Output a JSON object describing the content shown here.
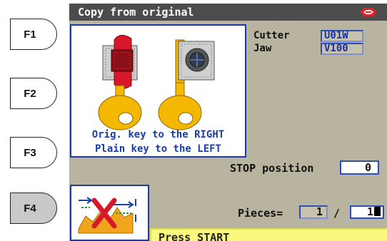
{
  "fkeys": {
    "f1": "F1",
    "f2": "F2",
    "f3": "F3",
    "f4": "F4"
  },
  "header": {
    "title": "Copy from original",
    "brand_icon": "silca-logo-icon"
  },
  "illustration": {
    "original_key_icon": "yellow-key-red-clamp-icon",
    "plain_key_icon": "yellow-key-grey-clamp-icon",
    "line1": "Orig. key to the RIGHT",
    "line2": "Plain key to the LEFT"
  },
  "params": {
    "cutter_label": "Cutter",
    "cutter_value": "U01W",
    "jaw_label": "Jaw",
    "jaw_value": "V100"
  },
  "stop": {
    "label": "STOP position",
    "value": "0"
  },
  "cut_mode_icon": "cutting-cancel-icon",
  "pieces": {
    "label": "Pieces=",
    "done": "1",
    "separator": "/",
    "total": "1"
  },
  "status": {
    "message": "Press START"
  },
  "colors": {
    "screen_bg": "#b9b49f",
    "titlebar_bg": "#4c4c4c",
    "accent_blue": "#1a3fa8",
    "status_bg": "#fbf880",
    "key_yellow": "#f5b800",
    "clamp_red": "#d8182a"
  }
}
